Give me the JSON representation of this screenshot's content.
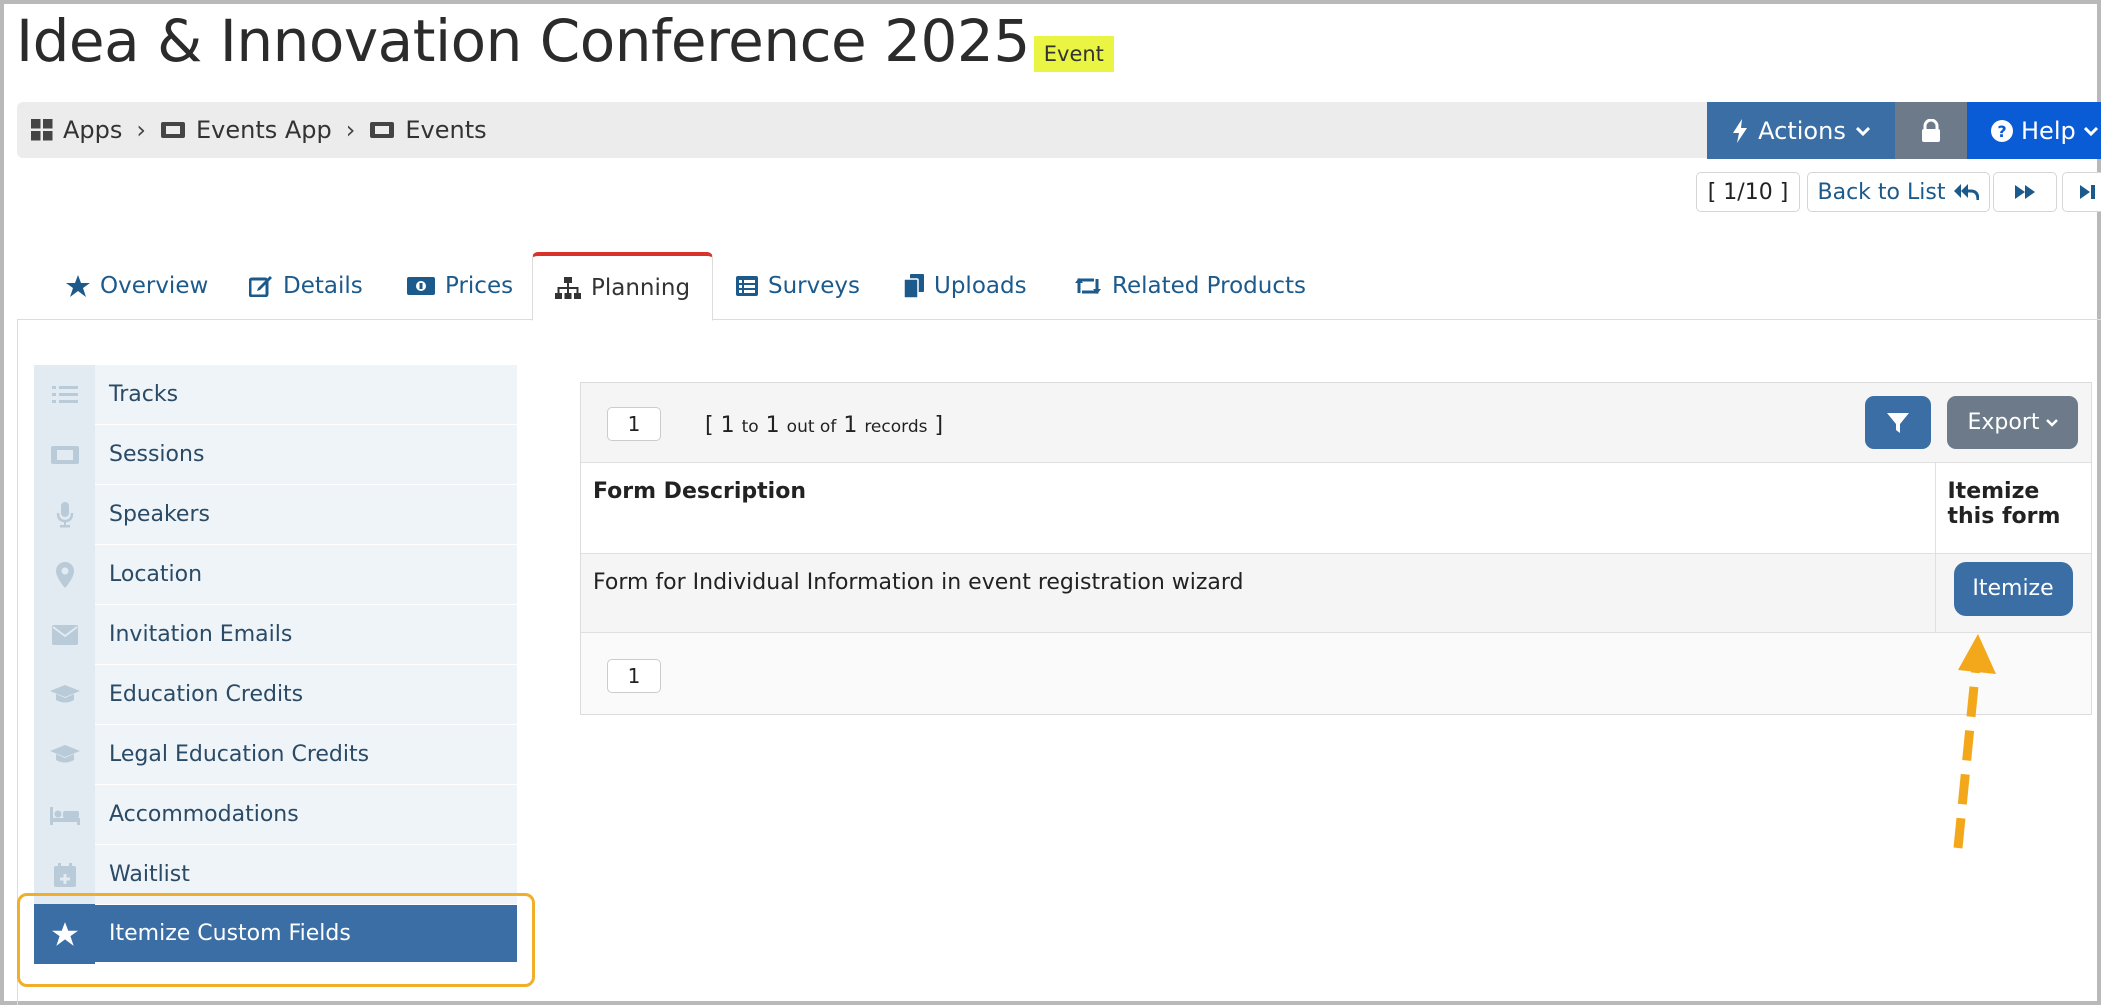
{
  "header": {
    "title": "Idea & Innovation Conference 2025",
    "badge": "Event"
  },
  "breadcrumb": [
    {
      "label": "Apps",
      "icon": "grid-icon"
    },
    {
      "label": "Events App",
      "icon": "ticket-icon"
    },
    {
      "label": "Events",
      "icon": "ticket-icon"
    }
  ],
  "toolbar": {
    "actions_label": "Actions",
    "help_label": "Help"
  },
  "pager": {
    "position": "[ 1/10 ]",
    "back_label": "Back to List"
  },
  "tabs": [
    {
      "label": "Overview",
      "icon": "star-icon"
    },
    {
      "label": "Details",
      "icon": "edit-icon"
    },
    {
      "label": "Prices",
      "icon": "money-icon"
    },
    {
      "label": "Planning",
      "icon": "sitemap-icon",
      "active": true
    },
    {
      "label": "Surveys",
      "icon": "list-icon"
    },
    {
      "label": "Uploads",
      "icon": "files-icon"
    },
    {
      "label": "Related Products",
      "icon": "retweet-icon"
    }
  ],
  "sidebar": {
    "items": [
      {
        "label": "Tracks",
        "icon": "list-icon"
      },
      {
        "label": "Sessions",
        "icon": "ticket-icon"
      },
      {
        "label": "Speakers",
        "icon": "microphone-icon"
      },
      {
        "label": "Location",
        "icon": "map-marker-icon"
      },
      {
        "label": "Invitation Emails",
        "icon": "envelope-icon"
      },
      {
        "label": "Education Credits",
        "icon": "graduation-cap-icon"
      },
      {
        "label": "Legal Education Credits",
        "icon": "graduation-cap-icon"
      },
      {
        "label": "Accommodations",
        "icon": "bed-icon"
      },
      {
        "label": "Waitlist",
        "icon": "calendar-plus-icon"
      },
      {
        "label": "Itemize Custom Fields",
        "icon": "star-icon",
        "selected": true
      }
    ]
  },
  "grid": {
    "page_top": "1",
    "page_bottom": "1",
    "records": {
      "open": "[",
      "from": "1",
      "to_word": "to",
      "to": "1",
      "out_of": "out of",
      "total": "1",
      "records_word": "records",
      "close": "]"
    },
    "export_label": "Export",
    "columns": [
      "Form Description",
      "Itemize this form"
    ],
    "rows": [
      {
        "description": "Form for Individual Information in event registration wizard",
        "action": "Itemize"
      }
    ]
  },
  "colors": {
    "primary": "#3a6ea5",
    "help": "#0a5bd6",
    "badge": "#e9f542",
    "highlight": "#f0ae2a",
    "active_tab_border": "#d9322a"
  }
}
